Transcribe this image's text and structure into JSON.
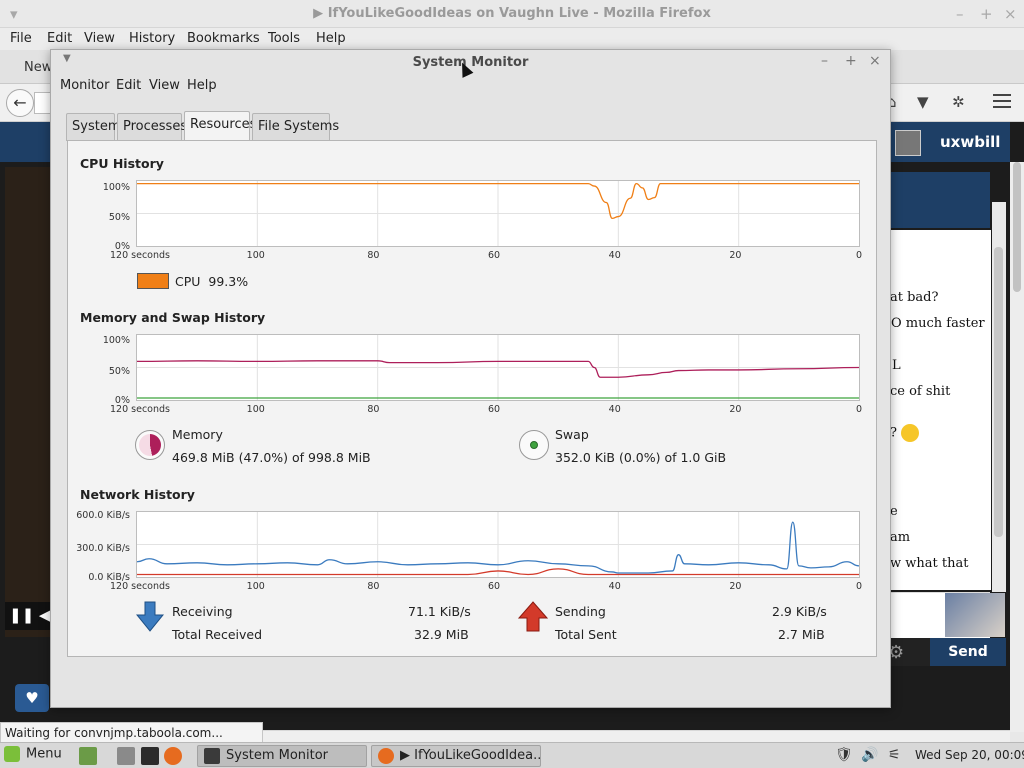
{
  "firefox": {
    "title": "▶ IfYouLikeGoodIdeas on Vaughn Live - Mozilla Firefox",
    "menu": [
      "File",
      "Edit",
      "View",
      "History",
      "Bookmarks",
      "Tools",
      "Help"
    ],
    "tab_label": "New",
    "status_text": "Waiting for convnjmp.taboola.com...",
    "site_user": "uxwbill",
    "chat_lines": [
      "at bad?",
      "O much faster",
      "L",
      "ce of shit",
      "? ",
      "e",
      "am",
      "w what that"
    ],
    "send_label": "Send"
  },
  "sysmon": {
    "title": "System Monitor",
    "menu": [
      "Monitor",
      "Edit",
      "View",
      "Help"
    ],
    "tabs": [
      "System",
      "Processes",
      "Resources",
      "File Systems"
    ],
    "active_tab": "Resources",
    "cpu": {
      "title": "CPU History",
      "legend_label": "CPU",
      "legend_value": "99.3%",
      "color": "#f07f16"
    },
    "memory": {
      "title": "Memory and Swap History",
      "memory_label": "Memory",
      "memory_value": "469.8 MiB (47.0%) of 998.8 MiB",
      "swap_label": "Swap",
      "swap_value": "352.0 KiB (0.0%) of 1.0 GiB",
      "memory_color": "#ad1f5a",
      "swap_color": "#3fa33f"
    },
    "network": {
      "title": "Network History",
      "receiving_label": "Receiving",
      "receiving_value": "71.1 KiB/s",
      "total_received_label": "Total Received",
      "total_received_value": "32.9 MiB",
      "sending_label": "Sending",
      "sending_value": "2.9 KiB/s",
      "total_sent_label": "Total Sent",
      "total_sent_value": "2.7 MiB",
      "recv_color": "#3b7bbf",
      "send_color": "#d33a2a"
    },
    "axis": {
      "x_ticks": [
        "120 seconds",
        "100",
        "80",
        "60",
        "40",
        "20",
        "0"
      ],
      "pct_ticks": [
        "100%",
        "50%",
        "0%"
      ],
      "net_ticks": [
        "600.0 KiB/s",
        "300.0 KiB/s",
        "0.0 KiB/s"
      ]
    }
  },
  "taskbar": {
    "menu_label": "Menu",
    "windows": [
      "System Monitor",
      "▶ IfYouLikeGoodIdea..."
    ],
    "clock": "Wed Sep 20, 00:09"
  },
  "chart_data": [
    {
      "type": "line",
      "title": "CPU History",
      "xlabel": "seconds",
      "x": [
        120,
        110,
        100,
        90,
        80,
        70,
        60,
        50,
        45,
        44,
        42,
        41,
        40,
        38,
        37,
        36,
        35,
        34,
        33,
        32,
        30,
        20,
        10,
        0
      ],
      "series": [
        {
          "name": "CPU",
          "values": [
            99,
            99,
            99,
            99,
            99,
            99,
            99,
            99,
            99,
            95,
            68,
            42,
            45,
            75,
            99,
            92,
            73,
            76,
            99,
            99,
            99,
            99,
            99,
            99
          ]
        }
      ],
      "ylim": [
        0,
        100
      ]
    },
    {
      "type": "line",
      "title": "Memory and Swap History",
      "xlabel": "seconds",
      "x": [
        120,
        110,
        100,
        90,
        80,
        78,
        70,
        60,
        50,
        45,
        44,
        43,
        40,
        35,
        32,
        30,
        25,
        20,
        10,
        0
      ],
      "series": [
        {
          "name": "Memory",
          "values": [
            60,
            61,
            60,
            61,
            61,
            58,
            58,
            60,
            60,
            60,
            50,
            34,
            34,
            38,
            42,
            45,
            46,
            46,
            48,
            50
          ]
        },
        {
          "name": "Swap",
          "values": [
            0,
            0,
            0,
            0,
            0,
            0,
            0,
            0,
            0,
            0,
            0,
            0,
            0,
            0,
            0,
            0,
            0,
            0,
            0,
            0
          ]
        }
      ],
      "ylim": [
        0,
        100
      ]
    },
    {
      "type": "line",
      "title": "Network History",
      "xlabel": "seconds",
      "x": [
        120,
        118,
        115,
        110,
        105,
        100,
        95,
        90,
        88,
        85,
        80,
        75,
        70,
        65,
        60,
        55,
        50,
        45,
        41,
        40,
        35,
        31,
        30,
        29,
        25,
        20,
        15,
        12,
        11,
        10,
        8,
        5,
        2,
        0
      ],
      "series": [
        {
          "name": "Receiving",
          "values": [
            130,
            160,
            110,
            120,
            100,
            110,
            120,
            100,
            150,
            110,
            130,
            100,
            110,
            120,
            100,
            140,
            110,
            90,
            30,
            20,
            20,
            40,
            200,
            110,
            100,
            120,
            100,
            60,
            520,
            90,
            70,
            80,
            130,
            90
          ]
        },
        {
          "name": "Sending",
          "values": [
            5,
            5,
            5,
            5,
            5,
            5,
            5,
            5,
            5,
            5,
            5,
            5,
            5,
            5,
            40,
            5,
            60,
            5,
            5,
            5,
            5,
            5,
            5,
            5,
            5,
            5,
            5,
            5,
            5,
            5,
            5,
            5,
            5,
            5
          ]
        }
      ],
      "ylim": [
        0,
        600
      ]
    }
  ]
}
